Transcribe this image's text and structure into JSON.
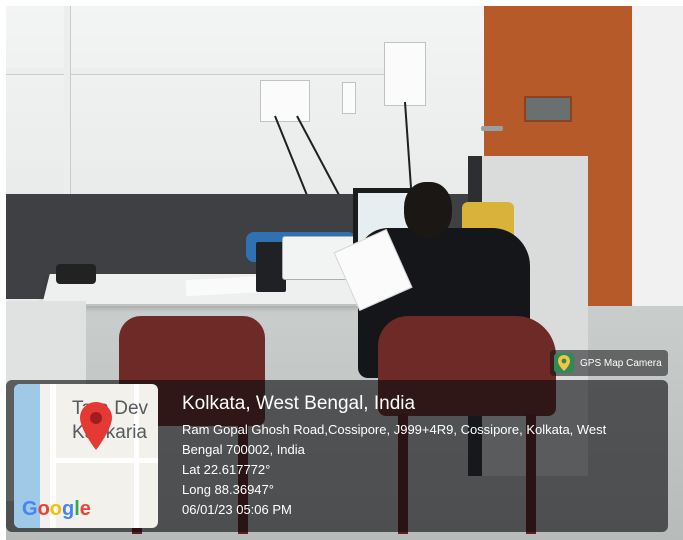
{
  "overlay": {
    "badge_label": "GPS Map Camera",
    "map_labels": {
      "line1": "Tara Dev",
      "line2": "Kankaria",
      "brand": "Google"
    },
    "location_title": "Kolkata, West Bengal, India",
    "address_line1": "Ram Gopal Ghosh Road,Cossipore, J999+4R9, Cossipore, Kolkata, West",
    "address_line2": "Bengal 700002, India",
    "latitude": "Lat 22.617772°",
    "longitude": "Long 88.36947°",
    "timestamp": "06/01/23 05:06 PM"
  },
  "colors": {
    "door": "#b75a2a",
    "chair": "#6d2a26",
    "pin": "#e53935",
    "google_blue": "#4285f4",
    "google_red": "#ea4335",
    "google_yellow": "#fbbc05",
    "google_green": "#34a853"
  },
  "icons": {
    "badge": "gps-map-camera-icon",
    "map_pin": "map-pin-icon"
  }
}
